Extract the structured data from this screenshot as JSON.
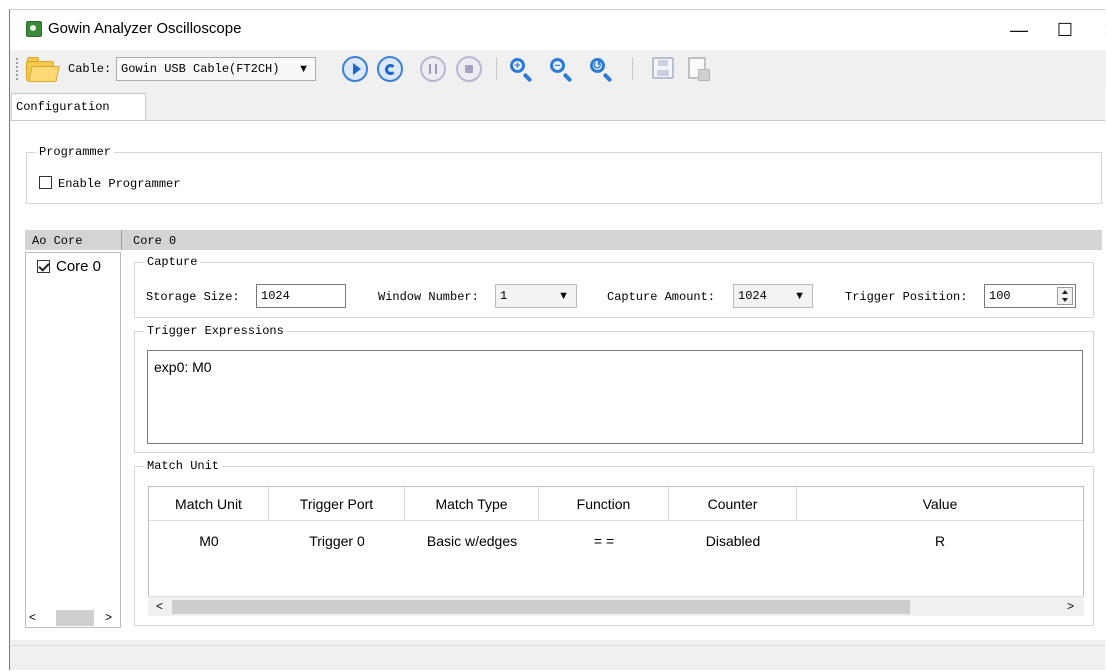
{
  "window": {
    "title": "Gowin Analyzer Oscilloscope",
    "controls": {
      "minimize_icon": "minimize-icon",
      "maximize_icon": "maximize-icon",
      "close_icon": "close-icon"
    }
  },
  "toolbar": {
    "cable_label": "Cable:",
    "cable_value": "Gowin USB Cable(FT2CH)",
    "icons": [
      "open-folder-icon",
      "run-icon",
      "repeat-run-icon",
      "step-icon",
      "stop-icon",
      "zoom-in-icon",
      "zoom-out-icon",
      "zoom-fit-icon",
      "save-icon",
      "export-icon"
    ]
  },
  "tabs": [
    {
      "label": "Configuration",
      "active": true
    }
  ],
  "programmer": {
    "group_title": "Programmer",
    "enable_label": "Enable Programmer",
    "enabled": false
  },
  "core_list": {
    "header": "Ao Core",
    "items": [
      {
        "label": "Core 0",
        "checked": true
      }
    ]
  },
  "core_panel": {
    "header": "Core 0",
    "capture": {
      "group_title": "Capture",
      "storage_size_label": "Storage Size:",
      "storage_size_value": "1024",
      "window_number_label": "Window Number:",
      "window_number_value": "1",
      "capture_amount_label": "Capture Amount:",
      "capture_amount_value": "1024",
      "trigger_position_label": "Trigger Position:",
      "trigger_position_value": "100"
    },
    "trigger_expressions": {
      "group_title": "Trigger Expressions",
      "text": "exp0: M0"
    },
    "match_unit": {
      "group_title": "Match Unit",
      "columns": [
        "Match Unit",
        "Trigger Port",
        "Match Type",
        "Function",
        "Counter",
        "Value"
      ],
      "rows": [
        [
          "M0",
          "Trigger 0",
          "Basic w/edges",
          "= =",
          "Disabled",
          "R"
        ]
      ]
    }
  },
  "colors": {
    "accent_blue": "#1f66c9",
    "header_gray": "#d4d4d4",
    "window_bg": "#f0f0f0"
  }
}
